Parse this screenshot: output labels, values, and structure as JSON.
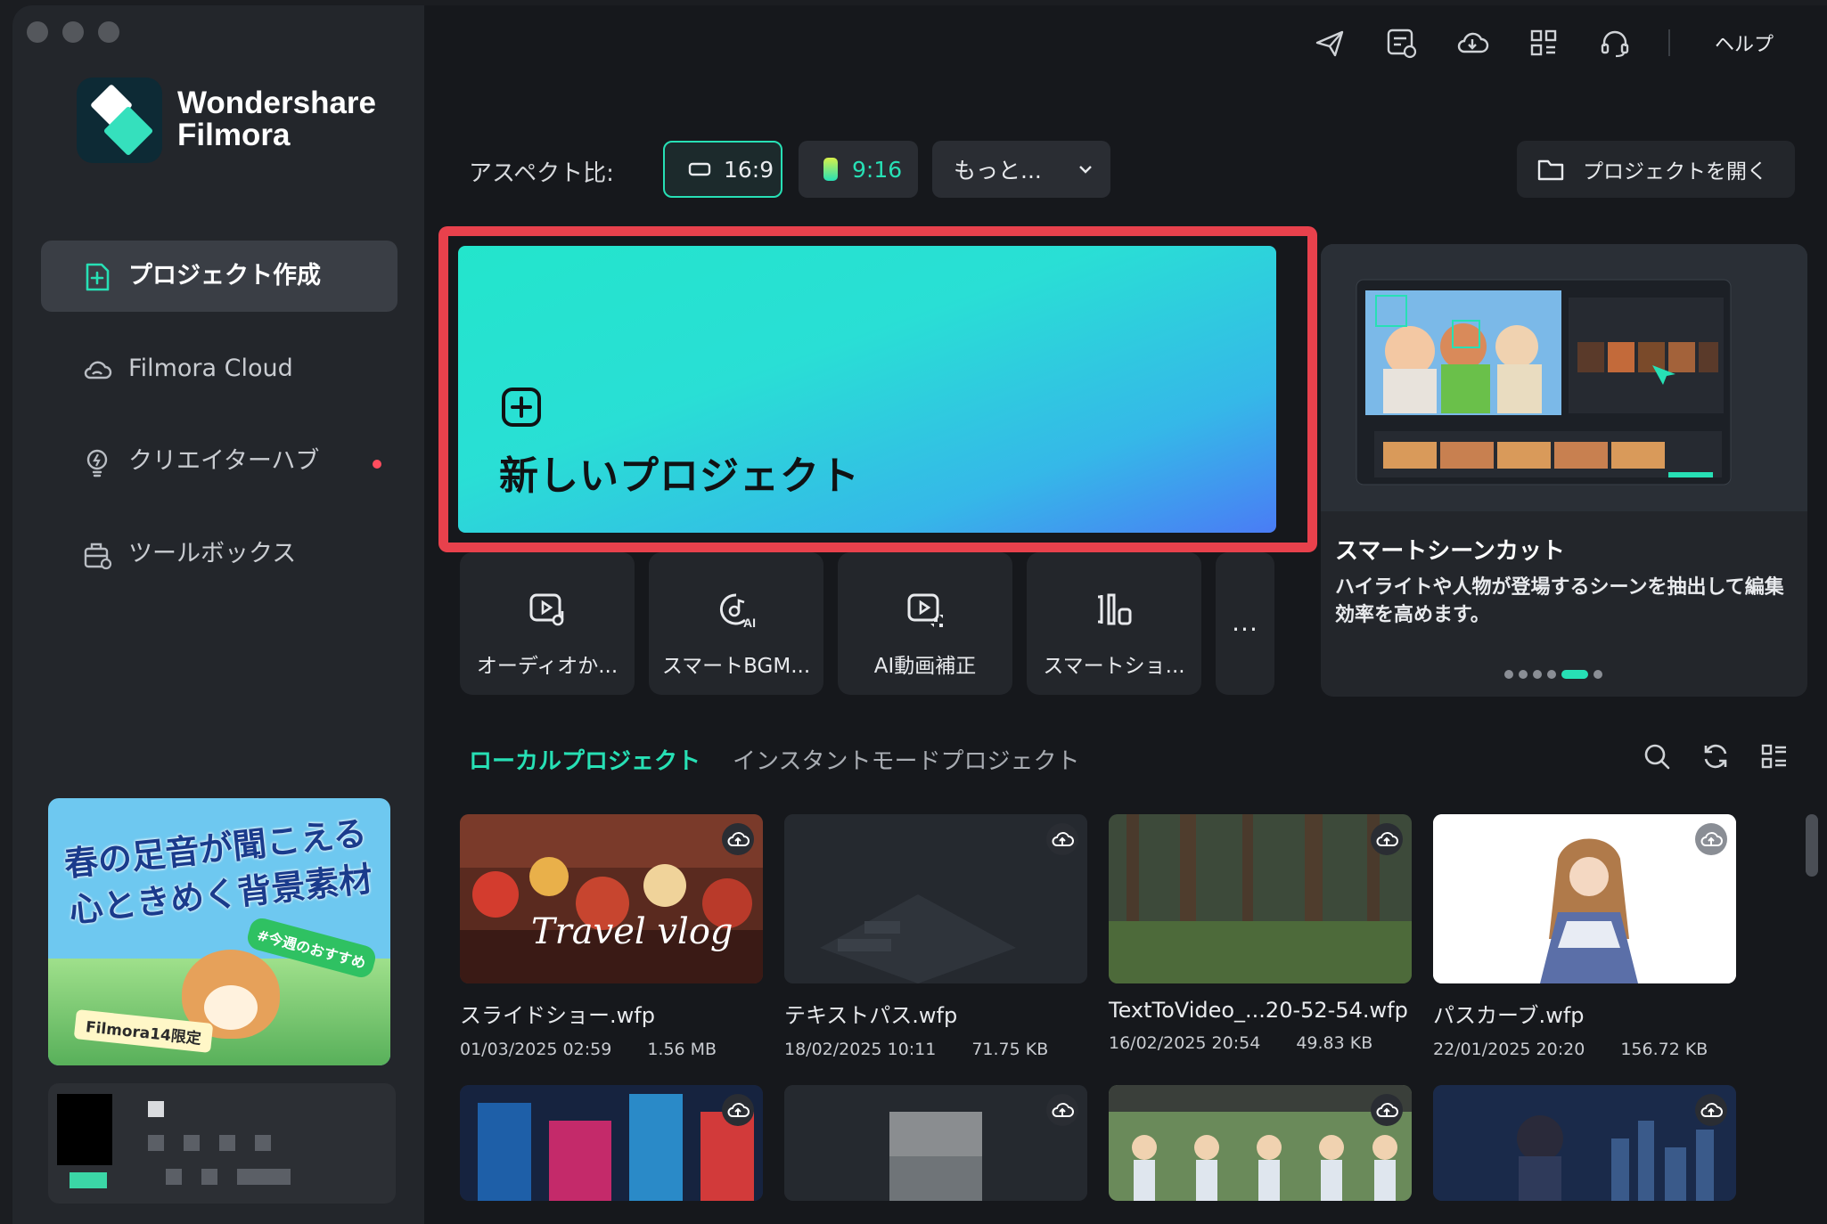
{
  "window": {
    "traffic_lights": [
      "close",
      "minimize",
      "zoom"
    ]
  },
  "brand": {
    "line1": "Wondershare",
    "line2": "Filmora"
  },
  "sidebar": {
    "items": [
      {
        "label": "プロジェクト作成",
        "icon": "new-project-icon",
        "active": true
      },
      {
        "label": "Filmora Cloud",
        "icon": "cloud-icon"
      },
      {
        "label": "クリエイターハブ",
        "icon": "bulb-icon",
        "badge": true
      },
      {
        "label": "ツールボックス",
        "icon": "toolbox-icon"
      }
    ],
    "promo": {
      "title": "春の足音が聞こえる 心ときめく背景素材",
      "tag": "#今週のおすすめ",
      "footer": "Filmora14限定"
    }
  },
  "topbar": {
    "icons": [
      "send-icon",
      "feedback-icon",
      "cloud-download-icon",
      "grid-icon",
      "support-headset-icon"
    ],
    "help_label": "ヘルプ"
  },
  "aspect": {
    "label": "アスペクト比:",
    "options": [
      {
        "label": "16:9",
        "selected": true
      },
      {
        "label": "9:16"
      },
      {
        "label": "もっと..."
      }
    ],
    "open_project_label": "プロジェクトを開く"
  },
  "hero": {
    "title": "新しいプロジェクト"
  },
  "tools": [
    {
      "label": "オーディオか...",
      "icon": "audio-video-icon"
    },
    {
      "label": "スマートBGM...",
      "icon": "smart-bgm-icon"
    },
    {
      "label": "AI動画補正",
      "icon": "ai-enhance-icon"
    },
    {
      "label": "スマートショ...",
      "icon": "smart-short-icon"
    },
    {
      "label": "..."
    }
  ],
  "feature": {
    "title": "スマートシーンカット",
    "description": "ハイライトや人物が登場するシーンを抽出して編集効率を高めます。",
    "dots": 6,
    "active_dot": 4
  },
  "projects_tabs": [
    {
      "label": "ローカルプロジェクト",
      "active": true
    },
    {
      "label": "インスタントモードプロジェクト"
    }
  ],
  "list_icons": [
    "search-icon",
    "refresh-icon",
    "list-view-icon"
  ],
  "projects": [
    {
      "name": "スライドショー.wfp",
      "date": "01/03/2025 02:59",
      "size": "1.56 MB",
      "thumb_overlay": "Travel vlog"
    },
    {
      "name": "テキストパス.wfp",
      "date": "18/02/2025 10:11",
      "size": "71.75 KB"
    },
    {
      "name": "TextToVideo_...20-52-54.wfp",
      "date": "16/02/2025 20:54",
      "size": "49.83 KB"
    },
    {
      "name": "パスカーブ.wfp",
      "date": "22/01/2025 20:20",
      "size": "156.72 KB"
    }
  ],
  "colors": {
    "accent": "#27e0b5",
    "highlight_frame": "#e8414c",
    "sidebar_bg": "#23262b",
    "main_bg": "#16181c"
  }
}
